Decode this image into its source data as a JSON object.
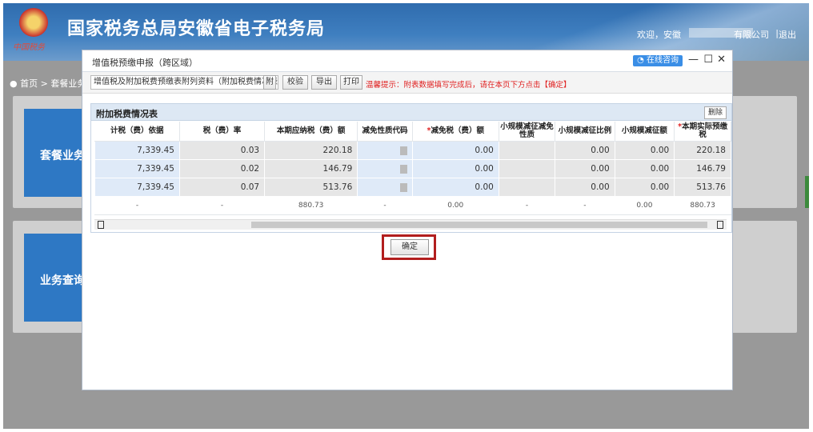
{
  "header": {
    "site_title": "国家税务总局安徽省电子税务局",
    "logo_text": "中国税务",
    "welcome": "欢迎，安徽",
    "company_suffix": "有限公司",
    "separator": "|",
    "logout": "退出"
  },
  "breadcrumb": "首页 > 套餐业务",
  "background_cards": [
    "套餐业务",
    "业务查询"
  ],
  "modal": {
    "title": "增值税预缴申报（跨区域）",
    "consult": "在线咨询",
    "minimize": "—",
    "maximize": "☐",
    "close": "✕"
  },
  "toolbar": {
    "select_value": "增值税及附加税费预缴表附列资料（附加税费情况表）",
    "select_icon": "附",
    "verify": "校验",
    "export": "导出",
    "print": "打印",
    "tip": "温馨提示：附表数据填写完成后，请在本页下方点击【确定】"
  },
  "grid": {
    "title": "附加税费情况表",
    "delete": "删除",
    "columns": [
      "计税（费）依据",
      "税（费）率",
      "本期应纳税（费）额",
      "减免性质代码",
      "减免税（费）额",
      "小规模减征减免性质",
      "小规模减征比例",
      "小规模减征额",
      "本期实际预缴税"
    ],
    "required_marks": [
      "",
      "",
      "",
      "",
      "*",
      "",
      "",
      "",
      "*"
    ],
    "rows": [
      [
        "7,339.45",
        "0.03",
        "220.18",
        "",
        "0.00",
        "",
        "0.00",
        "0.00",
        "220.18"
      ],
      [
        "7,339.45",
        "0.02",
        "146.79",
        "",
        "0.00",
        "",
        "0.00",
        "0.00",
        "146.79"
      ],
      [
        "7,339.45",
        "0.07",
        "513.76",
        "",
        "0.00",
        "",
        "0.00",
        "0.00",
        "513.76"
      ]
    ],
    "total": [
      "-",
      "-",
      "880.73",
      "-",
      "0.00",
      "-",
      "-",
      "0.00",
      "880.73"
    ]
  },
  "confirm": "确定",
  "colors": {
    "header_blue": "#2f6cae",
    "accent_red": "#b21e1e",
    "consult_blue": "#3a8ee6"
  }
}
